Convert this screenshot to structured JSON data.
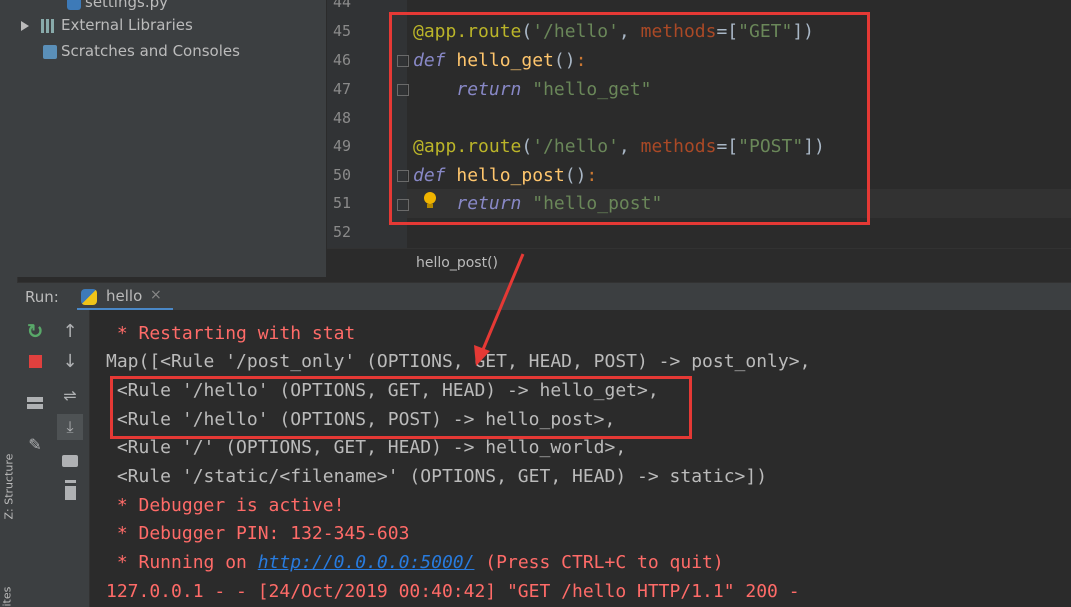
{
  "left_strip": {
    "structure_label": "Z: Structure",
    "favorites_label": "ites"
  },
  "project_tree": {
    "items": [
      {
        "label": "settings.py"
      },
      {
        "label": "External Libraries"
      },
      {
        "label": "Scratches and Consoles"
      }
    ]
  },
  "editor": {
    "line_numbers": [
      "44",
      "45",
      "46",
      "47",
      "48",
      "49",
      "50",
      "51",
      "52"
    ],
    "breadcrumb": "hello_post()"
  },
  "run_panel": {
    "run_label": "Run:",
    "tab_label": "hello",
    "tab_close": "×",
    "console_lines": [
      " * Restarting with stat",
      "Map([<Rule '/post_only' (OPTIONS, GET, HEAD, POST) -> post_only>,",
      " <Rule '/hello' (OPTIONS, GET, HEAD) -> hello_get>,",
      " <Rule '/hello' (OPTIONS, POST) -> hello_post>,",
      " <Rule '/' (OPTIONS, GET, HEAD) -> hello_world>,",
      " <Rule '/static/<filename>' (OPTIONS, GET, HEAD) -> static>])",
      " * Debugger is active!",
      " * Debugger PIN: 132-345-603"
    ],
    "running_prefix": " * Running on ",
    "running_url": "http://0.0.0.0:5000/",
    "running_suffix": " (Press CTRL+C to quit)",
    "request_log": "127.0.0.1 - - [24/Oct/2019 00:40:42] \"GET /hello HTTP/1.1\" 200 -"
  },
  "colors": {
    "highlight": "#e53935",
    "console_red": "#ff6b68",
    "link": "#287bde"
  }
}
